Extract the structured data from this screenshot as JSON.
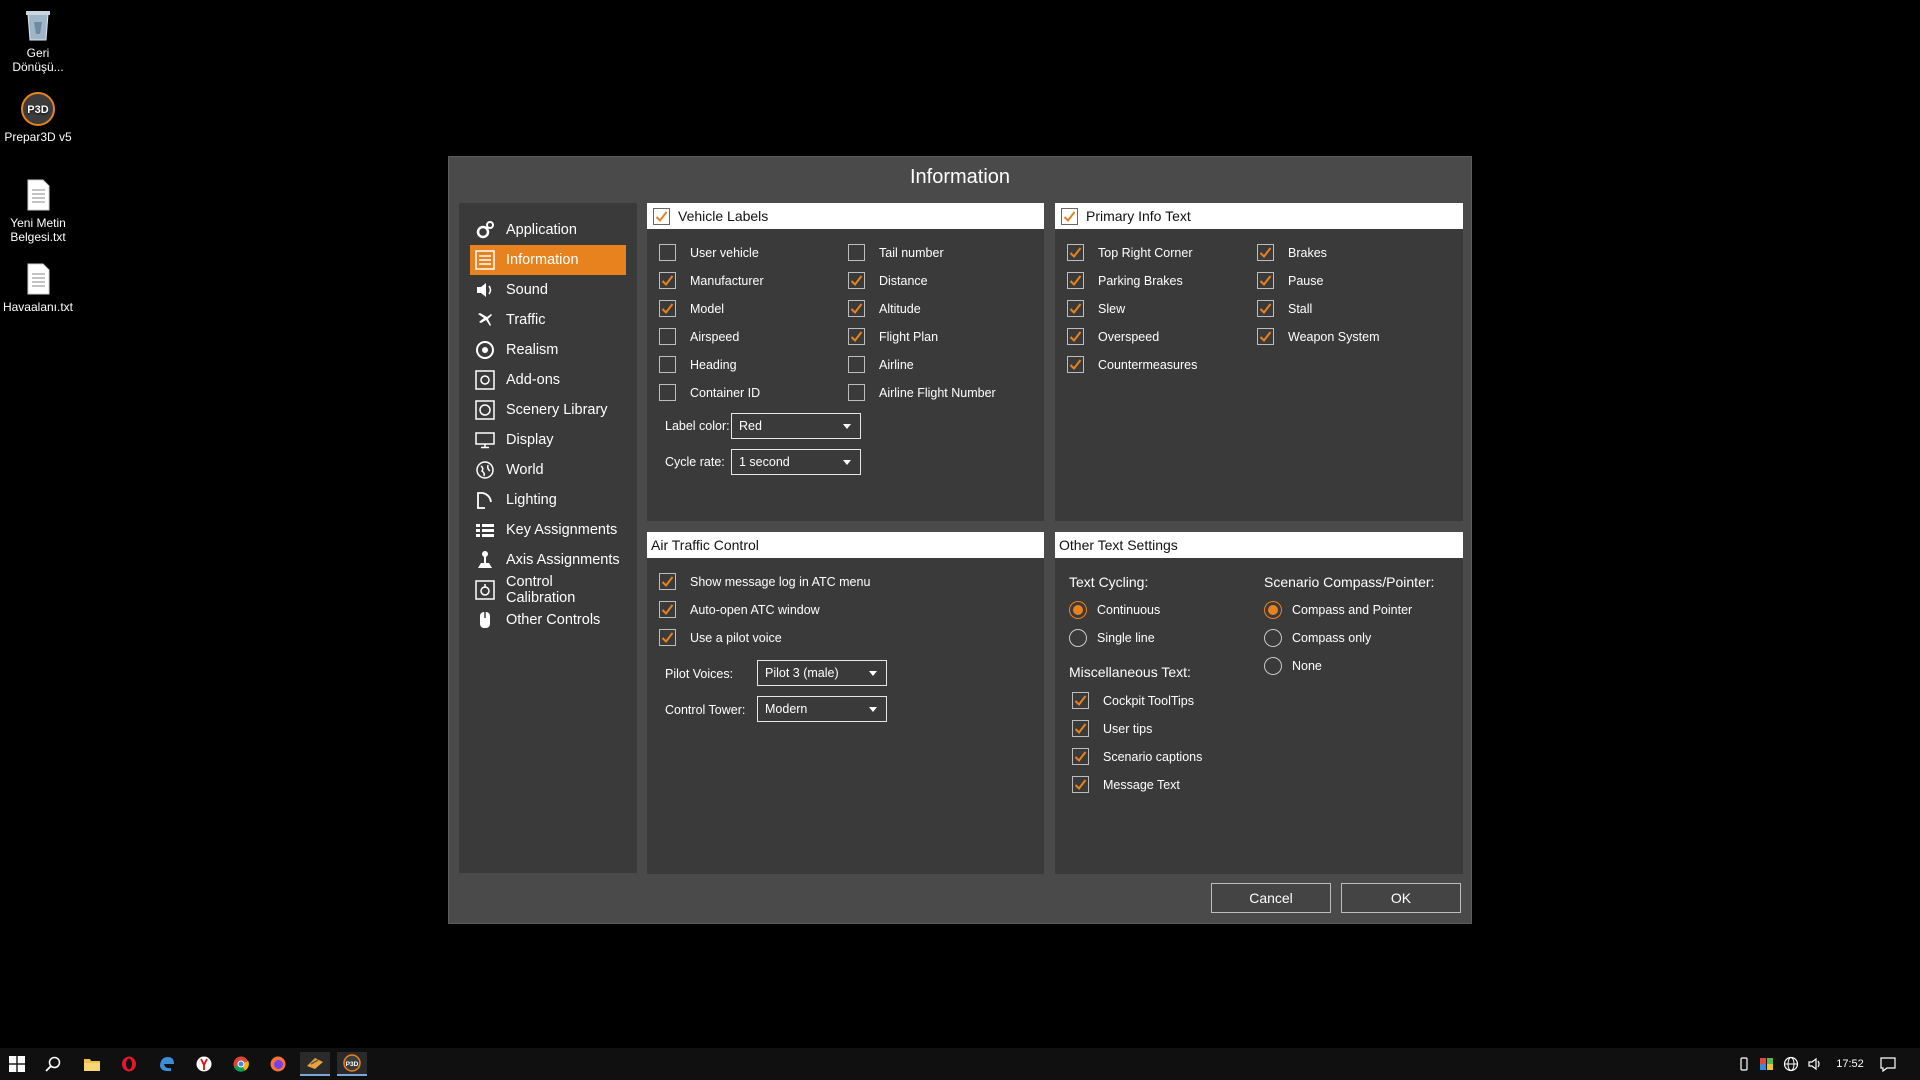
{
  "desktop": {
    "icons": [
      {
        "label": "Geri Dönüşü...",
        "icon": "recycle-bin-icon"
      },
      {
        "label": "Prepar3D v5",
        "icon": "prepar3d-app-icon"
      },
      {
        "label": "Yeni Metin Belgesi.txt",
        "icon": "text-file-icon"
      },
      {
        "label": "Havaalanı.txt",
        "icon": "text-file-icon"
      }
    ]
  },
  "dialog": {
    "title": "Information",
    "accent_color": "#e8821e",
    "nav": [
      {
        "label": "Application",
        "icon": "gears-icon",
        "active": false
      },
      {
        "label": "Information",
        "icon": "list-icon",
        "active": true
      },
      {
        "label": "Sound",
        "icon": "speaker-icon",
        "active": false
      },
      {
        "label": "Traffic",
        "icon": "airplanes-icon",
        "active": false
      },
      {
        "label": "Realism",
        "icon": "gauge-icon",
        "active": false
      },
      {
        "label": "Add-ons",
        "icon": "addons-icon",
        "active": false
      },
      {
        "label": "Scenery Library",
        "icon": "scenery-icon",
        "active": false
      },
      {
        "label": "Display",
        "icon": "monitor-icon",
        "active": false
      },
      {
        "label": "World",
        "icon": "globe-icon",
        "active": false
      },
      {
        "label": "Lighting",
        "icon": "lighting-icon",
        "active": false
      },
      {
        "label": "Key Assignments",
        "icon": "keyboard-icon",
        "active": false
      },
      {
        "label": "Axis Assignments",
        "icon": "joystick-icon",
        "active": false
      },
      {
        "label": "Control Calibration",
        "icon": "calibration-icon",
        "active": false
      },
      {
        "label": "Other Controls",
        "icon": "controller-icon",
        "active": false
      }
    ],
    "vehicle_labels": {
      "title": "Vehicle Labels",
      "checked": true,
      "left": [
        {
          "label": "User vehicle",
          "checked": false
        },
        {
          "label": "Manufacturer",
          "checked": true
        },
        {
          "label": "Model",
          "checked": true
        },
        {
          "label": "Airspeed",
          "checked": false
        },
        {
          "label": "Heading",
          "checked": false
        },
        {
          "label": "Container ID",
          "checked": false
        }
      ],
      "right": [
        {
          "label": "Tail number",
          "checked": false
        },
        {
          "label": "Distance",
          "checked": true
        },
        {
          "label": "Altitude",
          "checked": true
        },
        {
          "label": "Flight Plan",
          "checked": true
        },
        {
          "label": "Airline",
          "checked": false
        },
        {
          "label": "Airline Flight Number",
          "checked": false
        }
      ],
      "label_color_label": "Label color:",
      "label_color_value": "Red",
      "cycle_rate_label": "Cycle rate:",
      "cycle_rate_value": "1 second"
    },
    "primary_info": {
      "title": "Primary Info Text",
      "checked": true,
      "left": [
        {
          "label": "Top Right Corner",
          "checked": true
        },
        {
          "label": "Parking Brakes",
          "checked": true
        },
        {
          "label": "Slew",
          "checked": true
        },
        {
          "label": "Overspeed",
          "checked": true
        },
        {
          "label": "Countermeasures",
          "checked": true
        }
      ],
      "right": [
        {
          "label": "Brakes",
          "checked": true
        },
        {
          "label": "Pause",
          "checked": true
        },
        {
          "label": "Stall",
          "checked": true
        },
        {
          "label": "Weapon System",
          "checked": true
        }
      ]
    },
    "atc": {
      "title": "Air Traffic Control",
      "options": [
        {
          "label": "Show message log in ATC menu",
          "checked": true
        },
        {
          "label": "Auto-open ATC window",
          "checked": true
        },
        {
          "label": "Use a pilot voice",
          "checked": true
        }
      ],
      "pilot_voices_label": "Pilot Voices:",
      "pilot_voices_value": "Pilot 3 (male)",
      "control_tower_label": "Control Tower:",
      "control_tower_value": "Modern"
    },
    "other_text": {
      "title": "Other Text Settings",
      "text_cycling_label": "Text Cycling:",
      "text_cycling": [
        {
          "label": "Continuous",
          "selected": true
        },
        {
          "label": "Single line",
          "selected": false
        }
      ],
      "compass_label": "Scenario Compass/Pointer:",
      "compass": [
        {
          "label": "Compass and Pointer",
          "selected": true
        },
        {
          "label": "Compass only",
          "selected": false
        },
        {
          "label": "None",
          "selected": false
        }
      ],
      "misc_label": "Miscellaneous Text:",
      "misc": [
        {
          "label": "Cockpit ToolTips",
          "checked": true
        },
        {
          "label": "User tips",
          "checked": true
        },
        {
          "label": "Scenario captions",
          "checked": true
        },
        {
          "label": "Message Text",
          "checked": true
        }
      ]
    },
    "cancel_label": "Cancel",
    "ok_label": "OK"
  },
  "taskbar": {
    "apps": [
      "windows-start-icon",
      "search-icon",
      "file-explorer-icon",
      "opera-icon",
      "edge-icon",
      "yandex-icon",
      "chrome-icon",
      "firefox-icon",
      "tool-app-icon",
      "prepar3d-taskbar-icon"
    ],
    "clock": "17:52"
  }
}
